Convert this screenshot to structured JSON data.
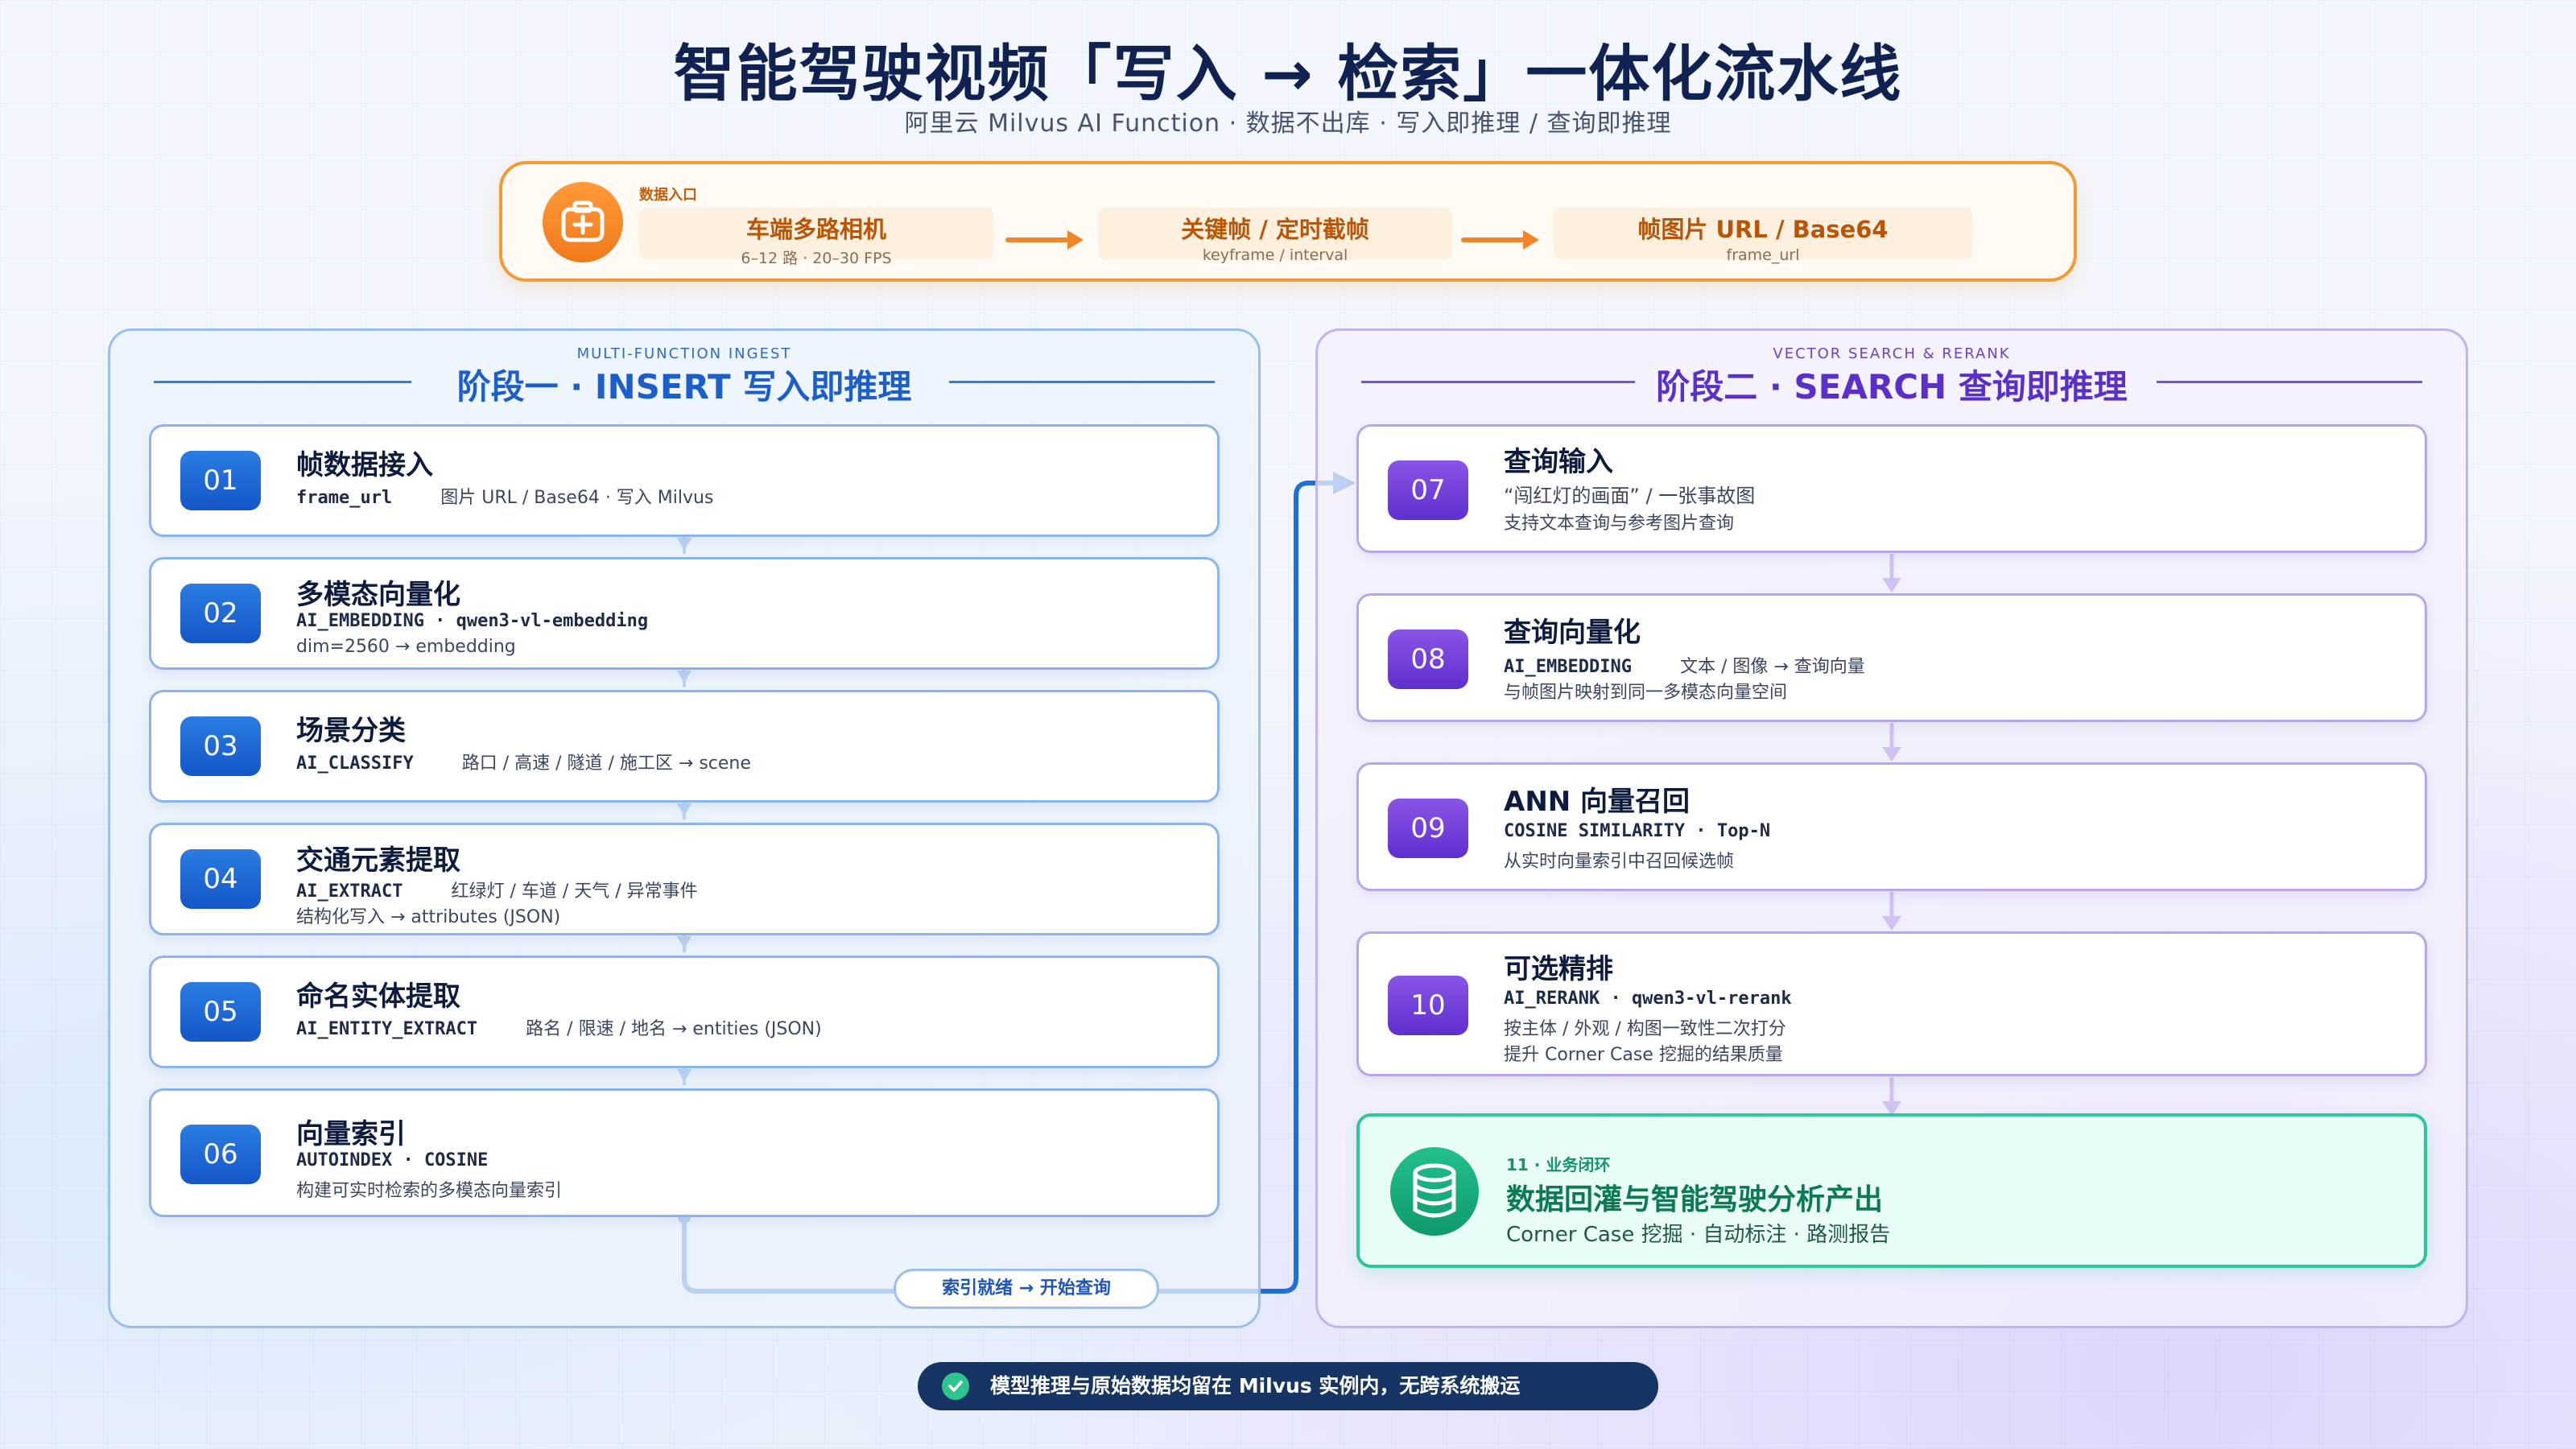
{
  "header": {
    "title": "智能驾驶视频「写入 → 检索」一体化流水线",
    "subtitle": "阿里云 Milvus AI Function · 数据不出库 · 写入即推理 / 查询即推理"
  },
  "entry": {
    "label": "数据入口",
    "icon": "camera-plus-icon",
    "boxes": [
      {
        "title": "车端多路相机",
        "sub": "6–12 路 · 20–30 FPS"
      },
      {
        "title": "关键帧 / 定时截帧",
        "sub": "keyframe / interval"
      },
      {
        "title": "帧图片 URL / Base64",
        "sub": "frame_url"
      }
    ]
  },
  "stage1": {
    "small": "MULTI-FUNCTION INGEST",
    "title": "阶段一 · INSERT 写入即推理",
    "steps": [
      {
        "num": "01",
        "title": "帧数据接入",
        "mono": "frame_url",
        "desc": "图片 URL / Base64 · 写入 Milvus",
        "line2": ""
      },
      {
        "num": "02",
        "title": "多模态向量化",
        "mono": "AI_EMBEDDING · qwen3-vl-embedding",
        "desc": "",
        "line2": "dim=2560 → embedding"
      },
      {
        "num": "03",
        "title": "场景分类",
        "mono": "AI_CLASSIFY",
        "desc": "路口 / 高速 / 隧道 / 施工区 → scene",
        "line2": ""
      },
      {
        "num": "04",
        "title": "交通元素提取",
        "mono": "AI_EXTRACT",
        "desc": "红绿灯 / 车道 / 天气 / 异常事件",
        "line2": "结构化写入 → attributes (JSON)"
      },
      {
        "num": "05",
        "title": "命名实体提取",
        "mono": "AI_ENTITY_EXTRACT",
        "desc": "路名 / 限速 / 地名 → entities (JSON)",
        "line2": ""
      },
      {
        "num": "06",
        "title": "向量索引",
        "mono": "AUTOINDEX · COSINE",
        "desc": "",
        "line2": "构建可实时检索的多模态向量索引"
      }
    ]
  },
  "stage2": {
    "small": "VECTOR SEARCH & RERANK",
    "title": "阶段二 · SEARCH 查询即推理",
    "steps": [
      {
        "num": "07",
        "title": "查询输入",
        "mono": "",
        "desc": "“闯红灯的画面” / 一张事故图",
        "line2": "支持文本查询与参考图片查询",
        "line3": ""
      },
      {
        "num": "08",
        "title": "查询向量化",
        "mono": "AI_EMBEDDING",
        "desc": "文本 / 图像 → 查询向量",
        "line2": "与帧图片映射到同一多模态向量空间",
        "line3": ""
      },
      {
        "num": "09",
        "title": "ANN 向量召回",
        "mono": "COSINE SIMILARITY · Top-N",
        "desc": "",
        "line2": "从实时向量索引中召回候选帧",
        "line3": ""
      },
      {
        "num": "10",
        "title": "可选精排",
        "mono": "AI_RERANK · qwen3-vl-rerank",
        "desc": "",
        "line2": "按主体 / 外观 / 构图一致性二次打分",
        "line3": "提升 Corner Case 挖掘的结果质量"
      }
    ],
    "final": {
      "tag": "11 · 业务闭环",
      "title": "数据回灌与智能驾驶分析产出",
      "desc": "Corner Case 挖掘 · 自动标注 · 路测报告",
      "icon": "database-icon"
    }
  },
  "bridge": {
    "label": "索引就绪 → 开始查询"
  },
  "footer": {
    "text": "模型推理与原始数据均留在 Milvus 实例内，无跨系统搬运",
    "icon": "check-circle-icon"
  },
  "colors": {
    "orange": "#f39a34",
    "blue": "#1e6fd6",
    "purple": "#6a3ad6",
    "green": "#2cc79a",
    "navy": "#163464"
  }
}
